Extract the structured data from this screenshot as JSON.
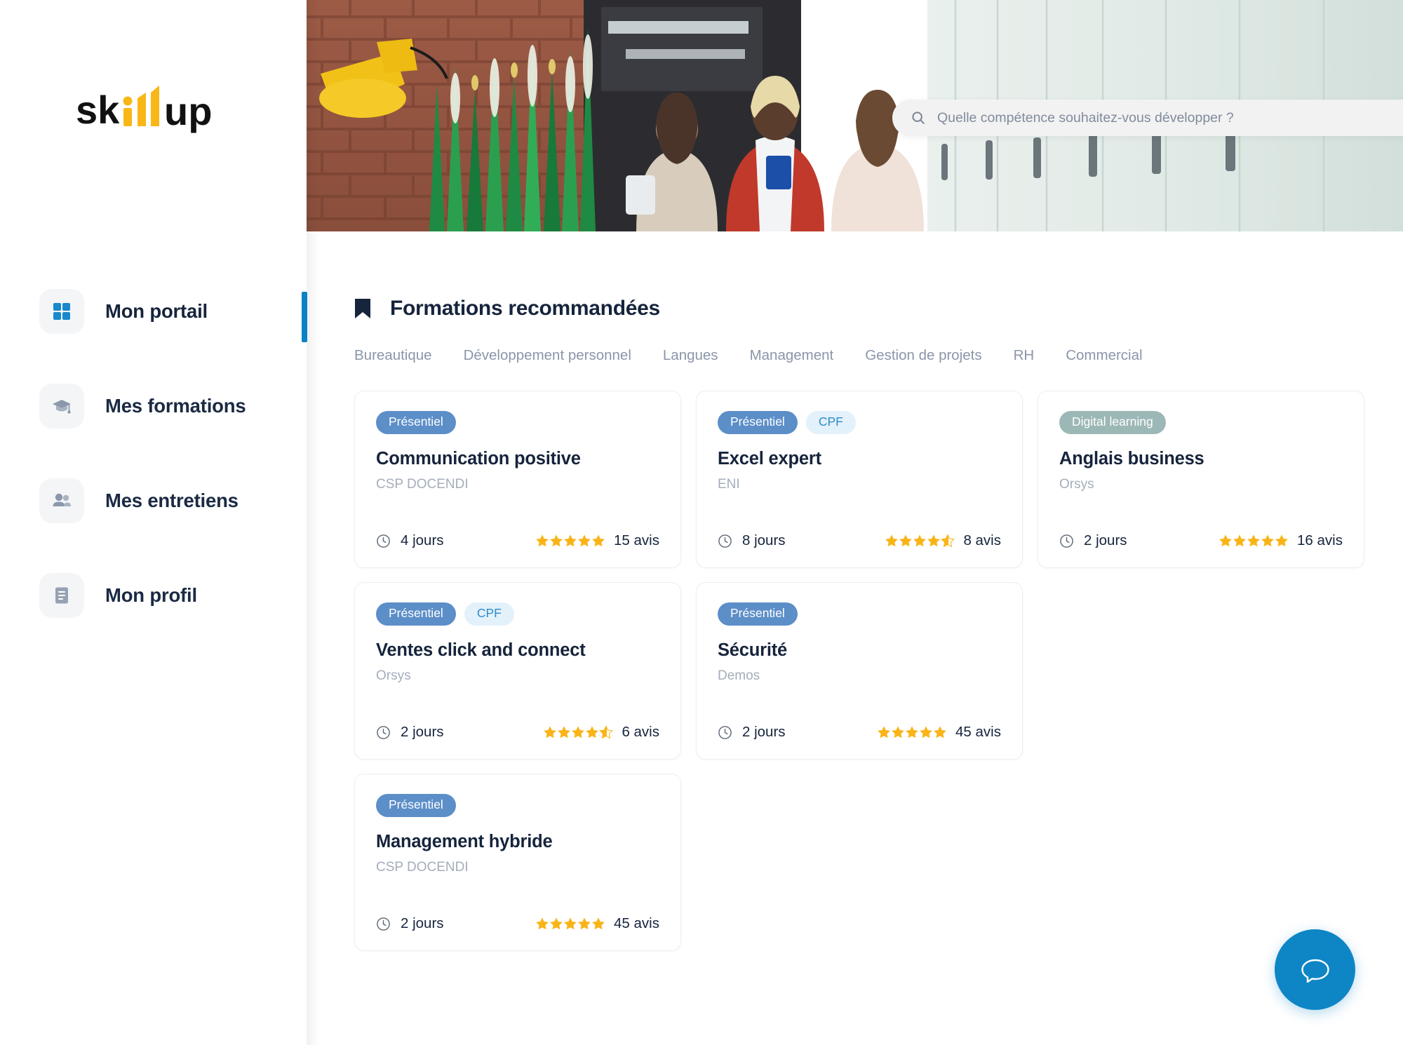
{
  "brand": {
    "logo_text_part1": "sk",
    "logo_text_part2": "ill",
    "logo_text_part3": "up",
    "logo_alt": "skillup",
    "accent_yellow": "#f9b717",
    "accent_blue": "#0c82c4",
    "ink": "#16243c"
  },
  "search": {
    "placeholder": "Quelle compétence souhaitez-vous développer ?",
    "value": "",
    "icon": "search-icon"
  },
  "sidebar": {
    "items": [
      {
        "label": "Mon portail",
        "icon": "grid-icon",
        "active": true
      },
      {
        "label": "Mes formations",
        "icon": "graduation-cap-icon",
        "active": false
      },
      {
        "label": "Mes entretiens",
        "icon": "people-icon",
        "active": false
      },
      {
        "label": "Mon profil",
        "icon": "document-icon",
        "active": false
      }
    ]
  },
  "main": {
    "section_icon": "bookmark-icon",
    "section_title": "Formations recommandées",
    "tabs": [
      {
        "label": "Bureautique"
      },
      {
        "label": "Développement personnel"
      },
      {
        "label": "Langues"
      },
      {
        "label": "Management"
      },
      {
        "label": "Gestion de projets"
      },
      {
        "label": "RH"
      },
      {
        "label": "Commercial"
      }
    ],
    "cards": [
      {
        "badges": [
          {
            "label": "Présentiel",
            "style": "presentiel"
          }
        ],
        "title": "Communication positive",
        "org": "CSP DOCENDI",
        "duration": "4 jours",
        "rating": 5,
        "reviews": "15 avis"
      },
      {
        "badges": [
          {
            "label": "Présentiel",
            "style": "presentiel"
          },
          {
            "label": "CPF",
            "style": "cpf"
          }
        ],
        "title": "Excel expert",
        "org": "ENI",
        "duration": "8 jours",
        "rating": 4.5,
        "reviews": "8 avis"
      },
      {
        "badges": [
          {
            "label": "Digital learning",
            "style": "digital"
          }
        ],
        "title": "Anglais business",
        "org": "Orsys",
        "duration": "2 jours",
        "rating": 5,
        "reviews": "16 avis"
      },
      {
        "badges": [
          {
            "label": "Présentiel",
            "style": "presentiel"
          },
          {
            "label": "CPF",
            "style": "cpf"
          }
        ],
        "title": "Ventes click and connect",
        "org": "Orsys",
        "duration": "2 jours",
        "rating": 4.5,
        "reviews": "6 avis"
      },
      {
        "badges": [
          {
            "label": "Présentiel",
            "style": "presentiel"
          }
        ],
        "title": "Sécurité",
        "org": "Demos",
        "duration": "2 jours",
        "rating": 5,
        "reviews": "45 avis"
      },
      {
        "badges": [
          {
            "label": "Présentiel",
            "style": "presentiel"
          }
        ],
        "title": "Management hybride",
        "org": "CSP DOCENDI",
        "duration": "2 jours",
        "rating": 5,
        "reviews": "45 avis"
      }
    ]
  },
  "chat": {
    "icon": "chat-bubble-icon",
    "color": "#0e86c6"
  },
  "colors": {
    "star": "#f9b418",
    "badge_presentiel_bg": "#5c8ec8",
    "badge_cpf_bg": "#e3f1fb",
    "badge_cpf_text": "#2e8bc9",
    "badge_digital_bg": "#9cb8b6",
    "card_border": "#eceef1",
    "muted_text": "#a4adbb",
    "tab_text": "#8a96a9"
  }
}
